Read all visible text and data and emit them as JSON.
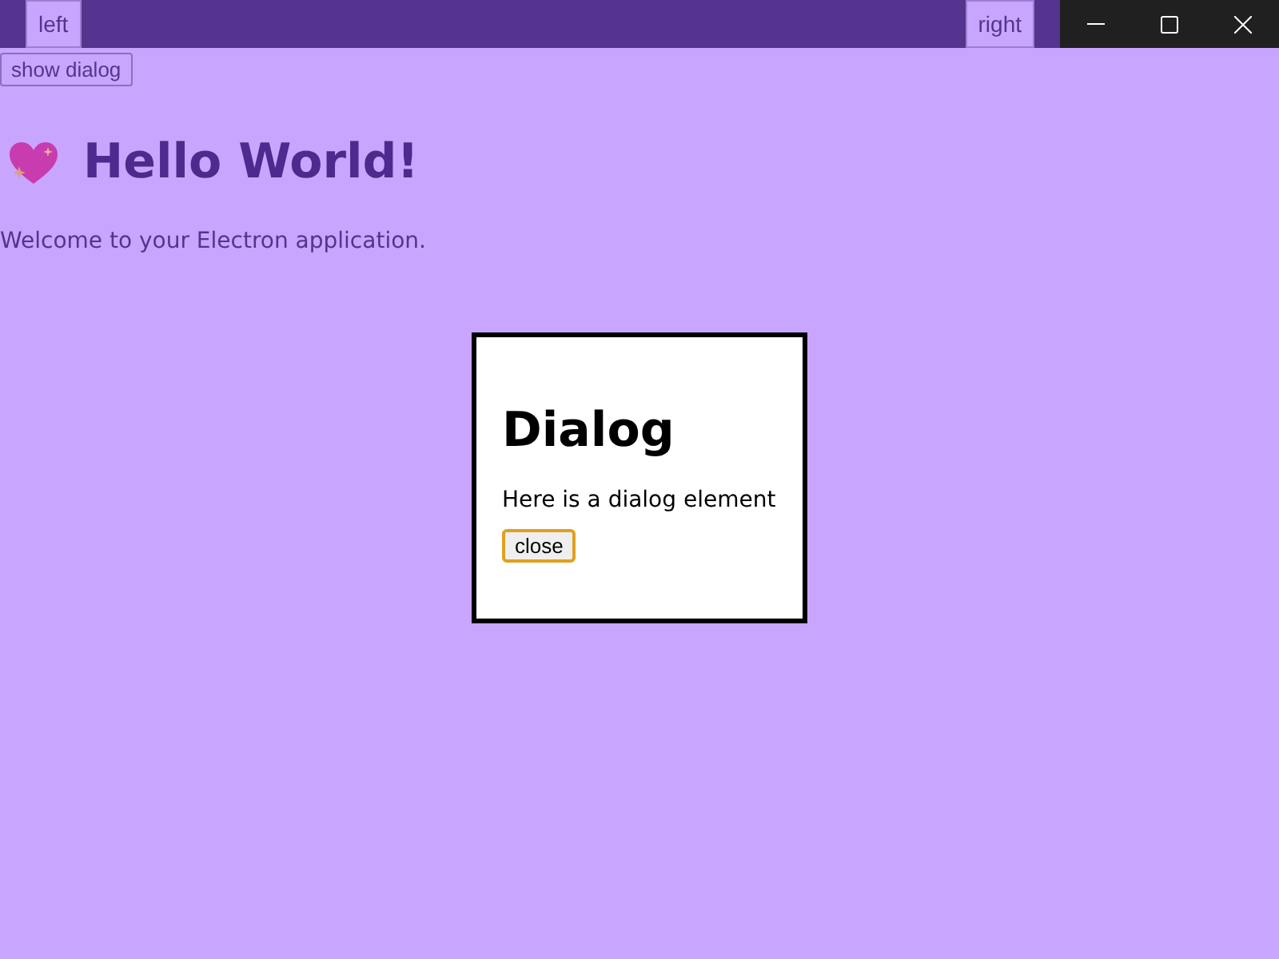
{
  "title_bar": {
    "left_button": "left",
    "right_button": "right"
  },
  "show_dialog_button": "show dialog",
  "heading": "Hello World!",
  "welcome": "Welcome to your Electron application.",
  "dialog": {
    "title": "Dialog",
    "text": "Here is a dialog element",
    "close_button": "close"
  }
}
